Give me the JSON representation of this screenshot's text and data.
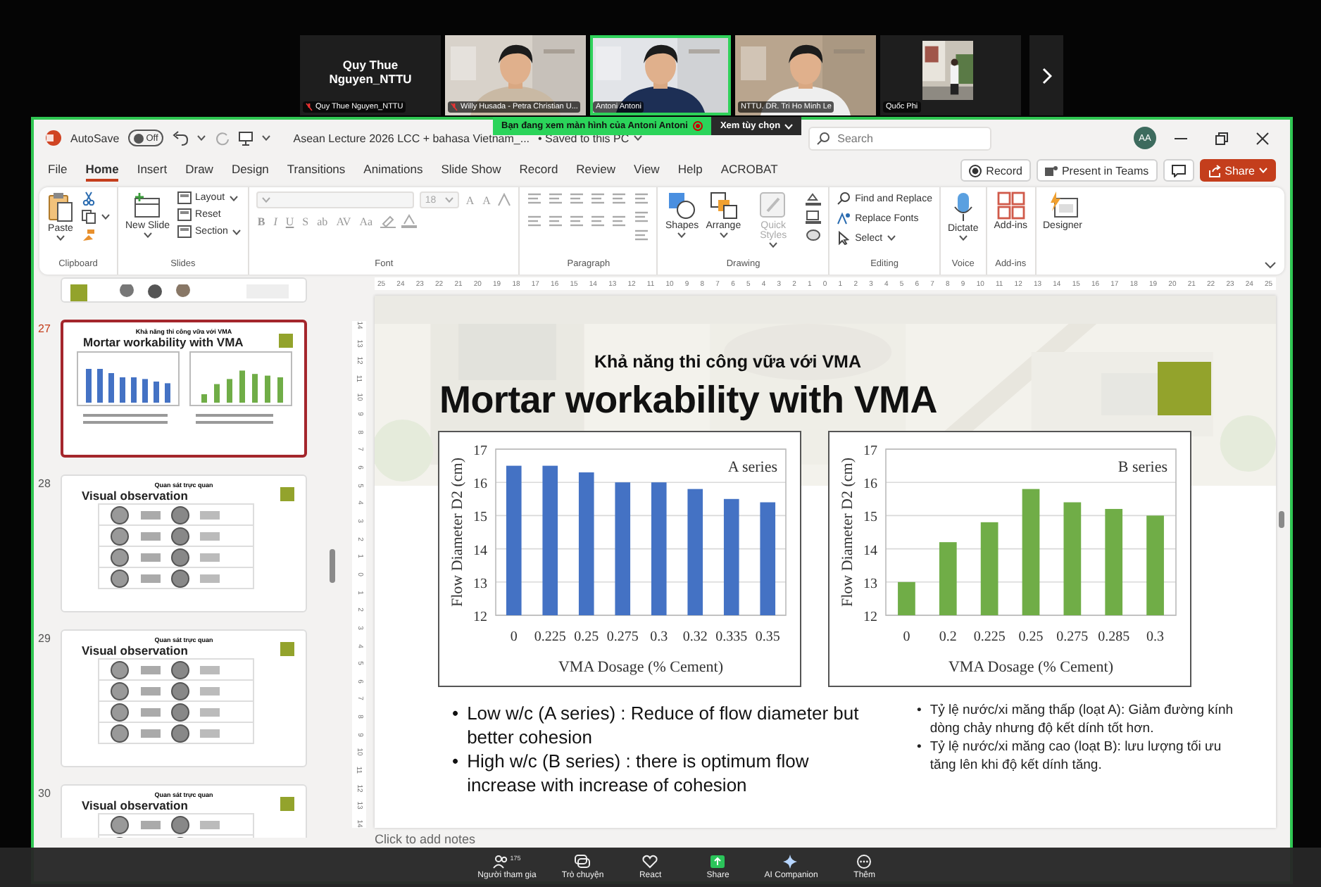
{
  "meeting": {
    "participants": [
      {
        "kind": "name",
        "name": "Quy Thue Nguyen_NTTU",
        "label": "Quy Thue Nguyen_NTTU",
        "muted": true,
        "speaking": false
      },
      {
        "kind": "video",
        "label": "Willy Husada - Petra Christian U...",
        "muted": true,
        "speaking": false
      },
      {
        "kind": "video",
        "label": "Antoni Antoni",
        "muted": false,
        "speaking": true
      },
      {
        "kind": "video",
        "label": "NTTU. DR. Tri Ho Minh Le",
        "muted": false,
        "speaking": false
      },
      {
        "label": "Quốc Phi",
        "muted": false,
        "speaking": false
      }
    ],
    "share_banner": {
      "text": "Bạn đang xem màn hình của",
      "presenter": "Antoni Antoni",
      "options_button": "Xem tùy chọn"
    },
    "toolbar": [
      {
        "kind": "people",
        "label": "Người tham gia",
        "badge": "175"
      },
      {
        "kind": "chat",
        "label": "Trò chuyện"
      },
      {
        "kind": "react",
        "label": "React"
      },
      {
        "kind": "share",
        "label": "Share"
      },
      {
        "kind": "ai",
        "label": "AI Companion"
      },
      {
        "kind": "more",
        "label": "Thêm"
      }
    ]
  },
  "window": {
    "autosave": {
      "label": "AutoSave",
      "state": "Off",
      "on": false
    },
    "title": "Asean Lecture 2026 LCC + bahasa Vietnam_...",
    "save_status": "• Saved to this PC",
    "search": {
      "placeholder": "Search"
    },
    "avatar": "AA"
  },
  "tabs": [
    {
      "label": "File",
      "selected": false
    },
    {
      "label": "Home",
      "selected": true
    },
    {
      "label": "Insert",
      "selected": false
    },
    {
      "label": "Draw",
      "selected": false
    },
    {
      "label": "Design",
      "selected": false
    },
    {
      "label": "Transitions",
      "selected": false
    },
    {
      "label": "Animations",
      "selected": false
    },
    {
      "label": "Slide Show",
      "selected": false
    },
    {
      "label": "Record",
      "selected": false
    },
    {
      "label": "Review",
      "selected": false
    },
    {
      "label": "View",
      "selected": false
    },
    {
      "label": "Help",
      "selected": false
    },
    {
      "label": "ACROBAT",
      "selected": false
    }
  ],
  "tab_actions": {
    "record": "Record",
    "present": "Present in Teams",
    "share": "Share"
  },
  "ribbon": {
    "groups": [
      {
        "kind": "clipboard",
        "label": "Clipboard",
        "items": [
          "Paste"
        ]
      },
      {
        "kind": "slides",
        "label": "Slides",
        "items": [
          "New Slide",
          "Layout",
          "Reset",
          "Section"
        ]
      },
      {
        "kind": "font",
        "label": "Font",
        "disabled": true,
        "font_size": "18",
        "size_buttons": [
          "A",
          "A"
        ],
        "format_buttons": [
          "B",
          "I",
          "U",
          "S",
          "ab",
          "AV",
          "Aa"
        ]
      },
      {
        "kind": "paragraph",
        "label": "Paragraph",
        "disabled": true
      },
      {
        "kind": "drawing",
        "label": "Drawing",
        "items": [
          {
            "label": "Shapes",
            "disabled": false
          },
          {
            "label": "Arrange",
            "disabled": false
          },
          {
            "label": "Quick Styles",
            "disabled": true
          }
        ]
      },
      {
        "kind": "editing",
        "label": "Editing",
        "items": [
          "Find and Replace",
          "Replace Fonts",
          "Select"
        ]
      },
      {
        "kind": "voice",
        "label": "Voice",
        "items": [
          "Dictate"
        ]
      },
      {
        "kind": "addins",
        "label": "Add-ins",
        "items": [
          "Add-ins"
        ]
      },
      {
        "kind": "designer",
        "items": [
          "Designer"
        ]
      }
    ]
  },
  "thumbnails": [
    {
      "kind": "partial",
      "selected": false
    },
    {
      "kind": "chart",
      "number": "27",
      "selected": true,
      "subtitle": "Khả năng thi công vữa với VMA",
      "title": "Mortar workability with VMA"
    },
    {
      "kind": "table",
      "number": "28",
      "selected": false,
      "subtitle": "Quan sát trực quan",
      "title": "Visual observation"
    },
    {
      "kind": "table",
      "number": "29",
      "selected": false,
      "subtitle": "Quan sát trực quan",
      "title": "Visual observation"
    },
    {
      "kind": "table",
      "number": "30",
      "selected": false,
      "subtitle": "Quan sát trực quan",
      "title": "Visual observation"
    }
  ],
  "rulers": {
    "horizontal": [
      "25",
      "24",
      "23",
      "22",
      "21",
      "20",
      "19",
      "18",
      "17",
      "16",
      "15",
      "14",
      "13",
      "12",
      "11",
      "10",
      "9",
      "8",
      "7",
      "6",
      "5",
      "4",
      "3",
      "2",
      "1",
      "0",
      "1",
      "2",
      "3",
      "4",
      "5",
      "6",
      "7",
      "8",
      "9",
      "10",
      "11",
      "12",
      "13",
      "14",
      "15",
      "16",
      "17",
      "18",
      "19",
      "20",
      "21",
      "22",
      "23",
      "24",
      "25"
    ],
    "vertical": [
      "14",
      "13",
      "12",
      "11",
      "10",
      "9",
      "8",
      "7",
      "6",
      "5",
      "4",
      "3",
      "2",
      "1",
      "0",
      "1",
      "2",
      "3",
      "4",
      "5",
      "6",
      "7",
      "8",
      "9",
      "10",
      "11",
      "12",
      "13",
      "14"
    ]
  },
  "slide": {
    "subtitle": "Khả năng thi công vữa với VMA",
    "title": "Mortar workability with VMA",
    "charts": [
      {
        "chart_data": {
          "type": "bar",
          "grid": true,
          "xlabel": "VMA Dosage (% Cement)",
          "ylabel": "Flow Diameter D2 (cm)",
          "categories": [
            "0",
            "0.225",
            "0.25",
            "0.275",
            "0.3",
            "0.32",
            "0.335",
            "0.35"
          ],
          "series": [
            {
              "name": "A series",
              "color": "#4472c4",
              "values": [
                16.5,
                16.5,
                16.3,
                16.0,
                16.0,
                15.8,
                15.5,
                15.4
              ]
            }
          ],
          "ylim": [
            12,
            17
          ],
          "yticks": [
            12,
            13,
            14,
            15,
            16,
            17
          ]
        }
      },
      {
        "chart_data": {
          "type": "bar",
          "grid": true,
          "xlabel": "VMA Dosage (% Cement)",
          "ylabel": "Flow Diameter D2 (cm)",
          "categories": [
            "0",
            "0.2",
            "0.225",
            "0.25",
            "0.275",
            "0.285",
            "0.3"
          ],
          "series": [
            {
              "name": "B series",
              "color": "#70ad47",
              "values": [
                13.0,
                14.2,
                14.8,
                15.8,
                15.4,
                15.2,
                15.0
              ]
            }
          ],
          "ylim": [
            12,
            17
          ],
          "yticks": [
            12,
            13,
            14,
            15,
            16,
            17
          ]
        }
      }
    ],
    "bullets_en": [
      {
        "marker": "•",
        "text": "Low w/c (A series) : Reduce of flow diameter but better cohesion"
      },
      {
        "marker": "•",
        "text": "High w/c (B series) : there is optimum flow increase with increase of cohesion"
      }
    ],
    "bullets_vi": [
      {
        "marker": "•",
        "text": "Tỷ lệ nước/xi măng thấp (loạt A): Giảm đường kính dòng chảy nhưng độ kết dính tốt hơn."
      },
      {
        "marker": "•",
        "text": "Tỷ lệ nước/xi măng cao (loạt B): lưu lượng tối ưu tăng lên khi độ kết dính tăng."
      }
    ]
  },
  "notes": {
    "placeholder": "Click to add notes"
  }
}
